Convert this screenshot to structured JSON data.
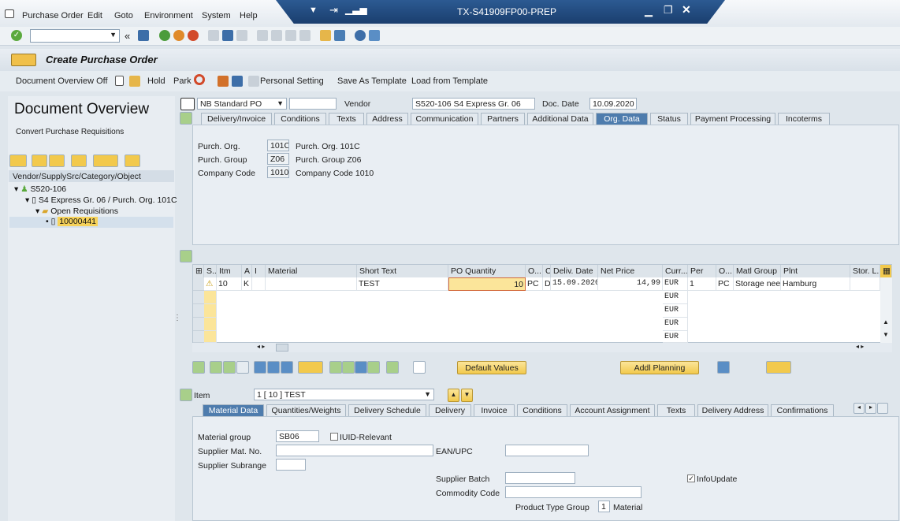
{
  "menu": [
    "Purchase Order",
    "Edit",
    "Goto",
    "Environment",
    "System",
    "Help"
  ],
  "window_title": "TX-S41909FP00-PREP",
  "app_title": "Create Purchase Order",
  "app_toolbar": {
    "doc_overview_off": "Document Overview Off",
    "hold": "Hold",
    "park": "Park",
    "personal_setting": "Personal Setting",
    "save_template": "Save As Template",
    "load_template": "Load from Template"
  },
  "left": {
    "title": "Document Overview",
    "convert": "Convert Purchase Requisitions",
    "tree_header": "Vendor/SupplySrc/Category/Object",
    "tree": [
      "S520-106",
      "S4 Express Gr. 06 / Purch. Org. 101C",
      "Open Requisitions",
      "10000441"
    ]
  },
  "header": {
    "po_type": "NB Standard PO",
    "vendor_label": "Vendor",
    "vendor_value": "S520-106 S4 Express Gr. 06",
    "docdate_label": "Doc. Date",
    "docdate_value": "10.09.2020",
    "tabs": [
      "Delivery/Invoice",
      "Conditions",
      "Texts",
      "Address",
      "Communication",
      "Partners",
      "Additional Data",
      "Org. Data",
      "Status",
      "Payment Processing",
      "Incoterms"
    ]
  },
  "org": {
    "porg_label": "Purch. Org.",
    "porg_code": "101C",
    "porg_desc": "Purch. Org. 101C",
    "pgrp_label": "Purch. Group",
    "pgrp_code": "Z06",
    "pgrp_desc": "Purch. Group Z06",
    "cc_label": "Company Code",
    "cc_code": "1010",
    "cc_desc": "Company Code 1010"
  },
  "items": {
    "columns": [
      "S...",
      "Itm",
      "A",
      "I",
      "Material",
      "Short Text",
      "PO Quantity",
      "O...",
      "C",
      "Deliv. Date",
      "Net Price",
      "Curr...",
      "Per",
      "O...",
      "Matl Group",
      "Plnt",
      "Stor. L..."
    ],
    "row": {
      "itm": "10",
      "a": "K",
      "text": "TEST",
      "qty": "10",
      "oun": "PC",
      "c": "D",
      "date": "15.09.2020",
      "price": "14,99",
      "curr": "EUR",
      "per": "1",
      "opu": "PC",
      "matlgrp": "Storage nee...",
      "plant": "Hamburg"
    },
    "empty_curr": "EUR"
  },
  "buttons": {
    "default_values": "Default Values",
    "addl_planning": "Addl Planning"
  },
  "item_detail": {
    "item_label": "Item",
    "item_value": "1 [ 10 ] TEST",
    "tabs": [
      "Material Data",
      "Quantities/Weights",
      "Delivery Schedule",
      "Delivery",
      "Invoice",
      "Conditions",
      "Account Assignment",
      "Texts",
      "Delivery Address",
      "Confirmations"
    ],
    "matgrp_label": "Material group",
    "matgrp_value": "SB06",
    "iuid": "IUID-Relevant",
    "supmat_label": "Supplier Mat. No.",
    "ean_label": "EAN/UPC",
    "subrange_label": "Supplier Subrange",
    "batch_label": "Supplier Batch",
    "commodity_label": "Commodity Code",
    "ptg_label": "Product Type Group",
    "ptg_value": "1",
    "ptg_desc": "Material",
    "infoupdate": "InfoUpdate"
  }
}
